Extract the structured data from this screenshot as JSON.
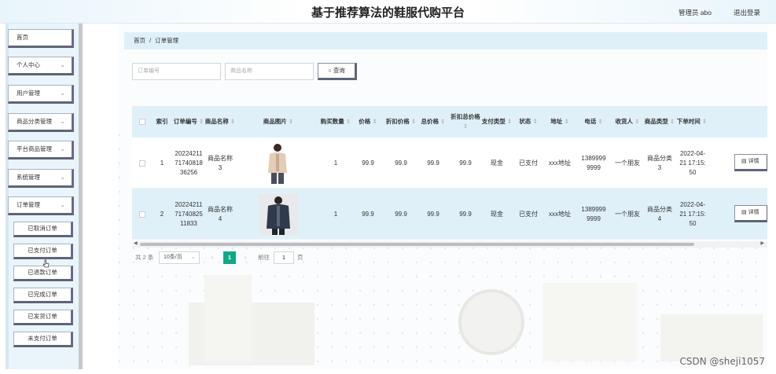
{
  "header": {
    "title": "基于推荐算法的鞋服代购平台",
    "admin_label": "管理员 abo",
    "logout_label": "退出登录"
  },
  "sidebar": {
    "items": [
      {
        "label": "首页",
        "has_chevron": false
      },
      {
        "label": "个人中心",
        "has_chevron": true
      },
      {
        "label": "用户管理",
        "has_chevron": true
      },
      {
        "label": "商品分类管理",
        "has_chevron": true
      },
      {
        "label": "平台商品管理",
        "has_chevron": true
      },
      {
        "label": "系统管理",
        "has_chevron": true
      },
      {
        "label": "订单管理",
        "has_chevron": true
      }
    ],
    "subitems": [
      "已取消订单",
      "已支付订单",
      "已退款订单",
      "已完成订单",
      "已发货订单",
      "未支付订单"
    ]
  },
  "breadcrumb": {
    "home": "首页",
    "separator": "/",
    "current": "订单管理"
  },
  "search": {
    "order_no_placeholder": "订单编号",
    "product_name_placeholder": "商品名称",
    "button_label": "查询"
  },
  "table": {
    "columns": [
      "索引",
      "订单编号",
      "商品名称",
      "商品图片",
      "购买数量",
      "价格",
      "折扣价格",
      "总价格",
      "折扣总价格",
      "支付类型",
      "状态",
      "地址",
      "电话",
      "收货人",
      "商品类型",
      "下单时间"
    ],
    "rows": [
      {
        "index": "1",
        "order_no": "202242117174081836256",
        "product_name": "商品名称3",
        "image": "man-beige-jacket",
        "qty": "1",
        "price": "99.9",
        "discount_price": "99.9",
        "total": "99.9",
        "discount_total": "99.9",
        "pay_type": "现金",
        "status": "已支付",
        "address": "xxx地址",
        "phone": "13899999999",
        "receiver": "一个朋友",
        "category": "商品分类3",
        "time": "2022-04-21 17:15:50"
      },
      {
        "index": "2",
        "order_no": "202242117174082511833",
        "product_name": "商品名称4",
        "image": "man-navy-coat",
        "qty": "1",
        "price": "99.9",
        "discount_price": "99.9",
        "total": "99.9",
        "discount_total": "99.9",
        "pay_type": "现金",
        "status": "已支付",
        "address": "xxx地址",
        "phone": "13899999999",
        "receiver": "一个朋友",
        "category": "商品分类4",
        "time": "2022-04-21 17:15:50"
      }
    ],
    "action_label": "详情"
  },
  "pagination": {
    "total_label": "共 2 条",
    "page_size": "10条/页",
    "current_page": "1",
    "goto_label": "前往",
    "goto_value": "1",
    "page_suffix": "页"
  },
  "watermark": "CSDN @sheji1057",
  "colors": {
    "accent": "#12a887",
    "header_bg": "#dff0f9",
    "sidebar_bg": "#eaf4fb"
  }
}
